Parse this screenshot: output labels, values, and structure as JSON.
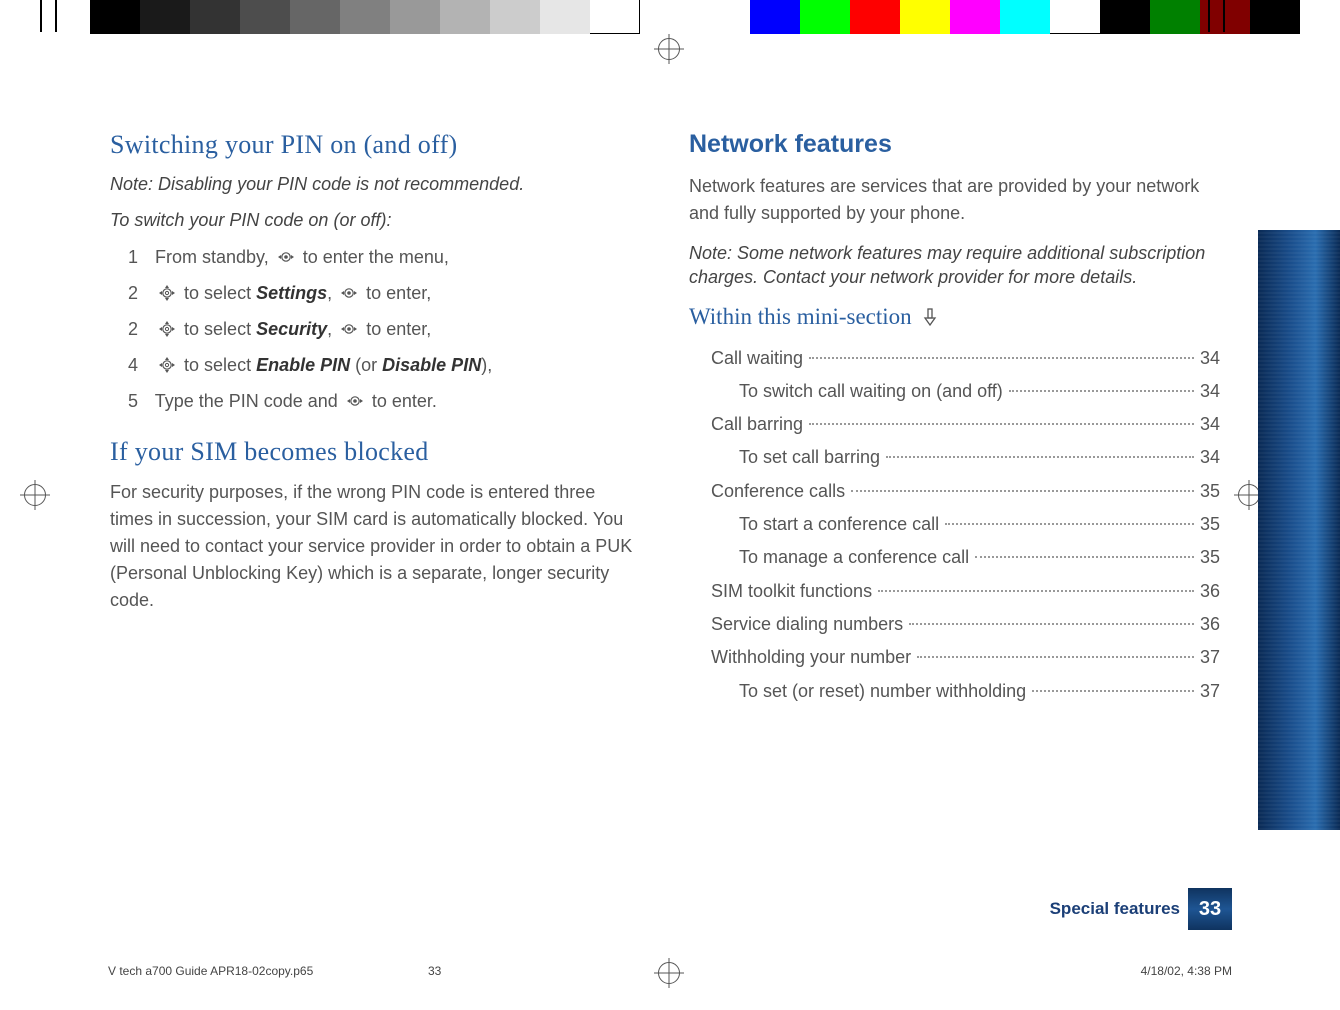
{
  "left": {
    "h_pin": "Switching your PIN on (and off)",
    "note_pin": "Note: Disabling your PIN code is not recommended.",
    "lead_pin": "To switch your PIN code on (or off):",
    "steps": {
      "s1_num": "1",
      "s1_a": "From standby,",
      "s1_b": "to enter the menu,",
      "s2_num": "2",
      "s2_a": "to select",
      "s2_bold": "Settings",
      "s2_b": ",",
      "s2_c": "to enter,",
      "s3_num": "2",
      "s3_a": "to select",
      "s3_bold": "Security",
      "s3_b": ",",
      "s3_c": "to enter,",
      "s4_num": "4",
      "s4_a": "to select",
      "s4_bold": "Enable PIN",
      "s4_b": "(or",
      "s4_bold2": "Disable PIN",
      "s4_c": "),",
      "s5_num": "5",
      "s5_a": "Type the PIN code and",
      "s5_b": "to enter."
    },
    "h_sim": "If your SIM becomes blocked",
    "body_sim": "For security purposes, if the wrong PIN code is entered three times in succession, your SIM card is automatically blocked. You will need to contact your service provider in order to obtain a PUK (Personal Unblocking Key) which is a separate, longer security code."
  },
  "right": {
    "h_net": "Network features",
    "body_net": "Network features are services that are provided by your network and fully supported by your phone.",
    "note_net": "Note: Some network features may require additional subscription charges. Contact your network provider for more details.",
    "h_mini": "Within this mini-section",
    "toc": [
      {
        "label": "Call waiting",
        "page": "34",
        "sub": false
      },
      {
        "label": "To switch call waiting on (and off)",
        "page": "34",
        "sub": true
      },
      {
        "label": "Call barring",
        "page": "34",
        "sub": false
      },
      {
        "label": "To set call barring",
        "page": "34",
        "sub": true
      },
      {
        "label": "Conference calls",
        "page": "35",
        "sub": false
      },
      {
        "label": "To start a conference call",
        "page": "35",
        "sub": true
      },
      {
        "label": "To manage a conference call",
        "page": "35",
        "sub": true
      },
      {
        "label": "SIM toolkit functions",
        "page": "36",
        "sub": false
      },
      {
        "label": "Service dialing numbers",
        "page": "36",
        "sub": false
      },
      {
        "label": "Withholding your number",
        "page": "37",
        "sub": false
      },
      {
        "label": "To set (or reset) number withholding",
        "page": "37",
        "sub": true
      }
    ]
  },
  "footer": {
    "section": "Special features",
    "page_num": "33",
    "file": "V tech a700 Guide APR18-02copy.p65",
    "sheet": "33",
    "date": "4/18/02, 4:38 PM"
  }
}
